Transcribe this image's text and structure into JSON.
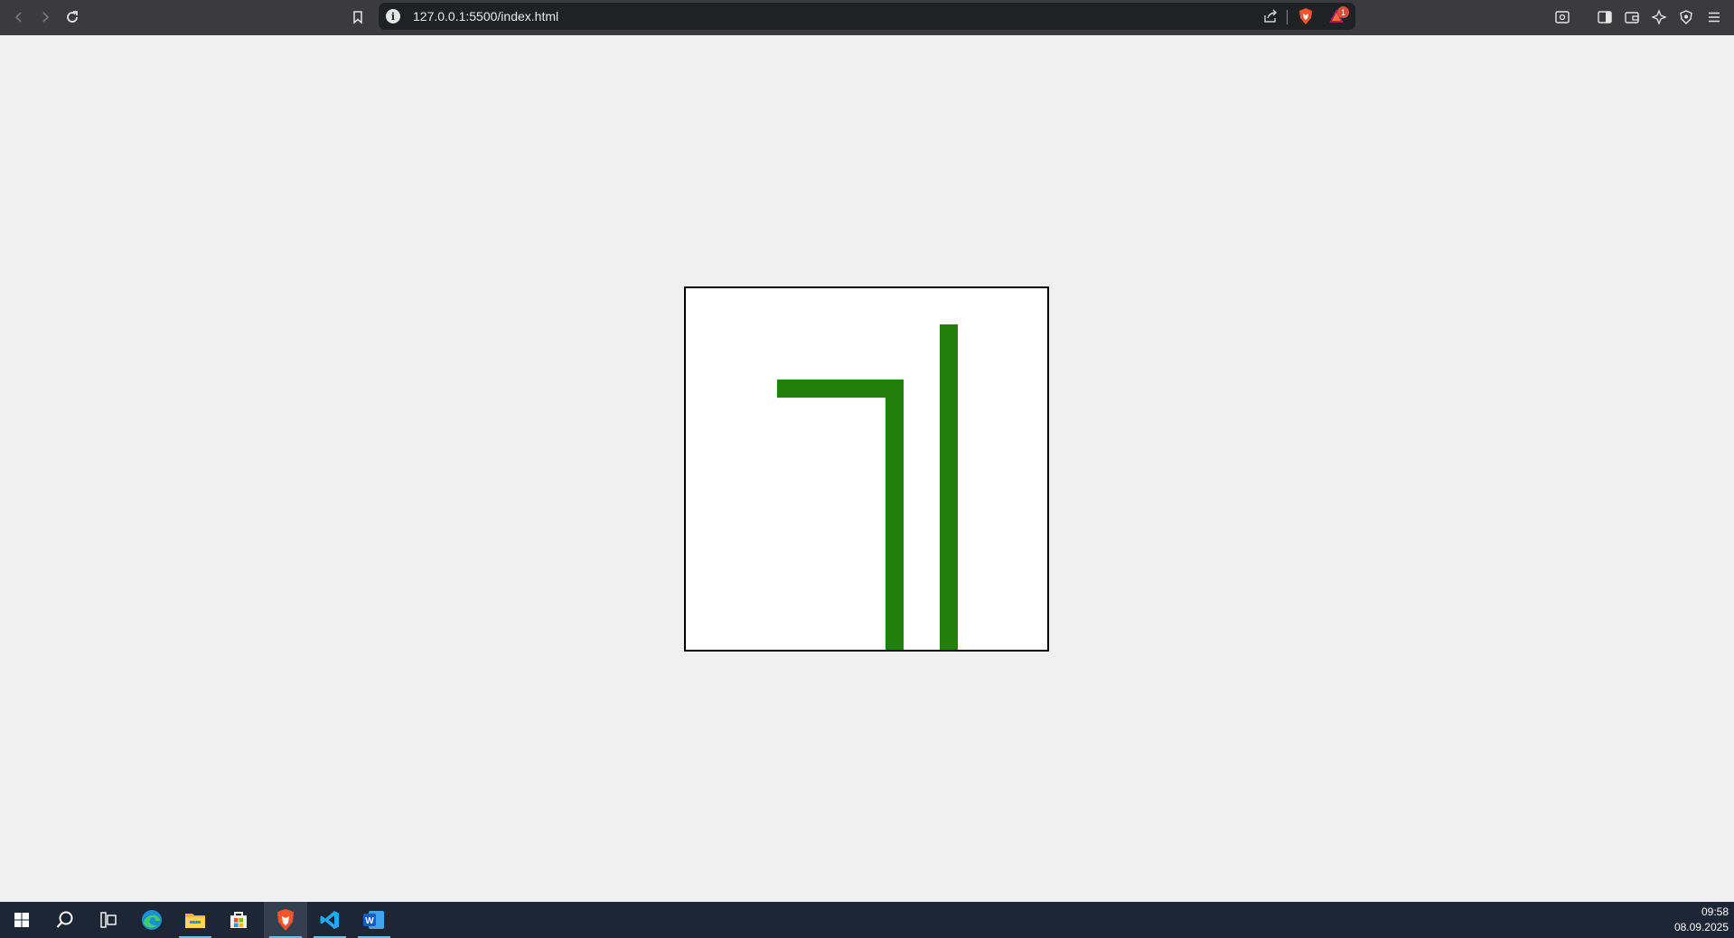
{
  "browser": {
    "url": "127.0.0.1:5500/index.html",
    "rewards_badge": "1",
    "icons": [
      "back-icon",
      "forward-icon",
      "reload-icon",
      "bookmark-icon",
      "info-icon",
      "share-icon",
      "brave-shield-icon",
      "brave-rewards-icon",
      "tab-search-icon",
      "sidebar-icon",
      "wallet-icon",
      "leo-ai-icon",
      "vpn-icon",
      "menu-icon"
    ]
  },
  "canvas": {
    "background": "#ffffff",
    "border_color": "#000000",
    "shape_color": "#217f0a"
  },
  "taskbar": {
    "time": "09:58",
    "date": "08.09.2025",
    "apps": [
      "windows-start-icon",
      "search-icon",
      "task-view-icon",
      "edge-icon",
      "file-explorer-icon",
      "microsoft-store-icon",
      "brave-icon",
      "vscode-icon",
      "word-icon"
    ]
  }
}
